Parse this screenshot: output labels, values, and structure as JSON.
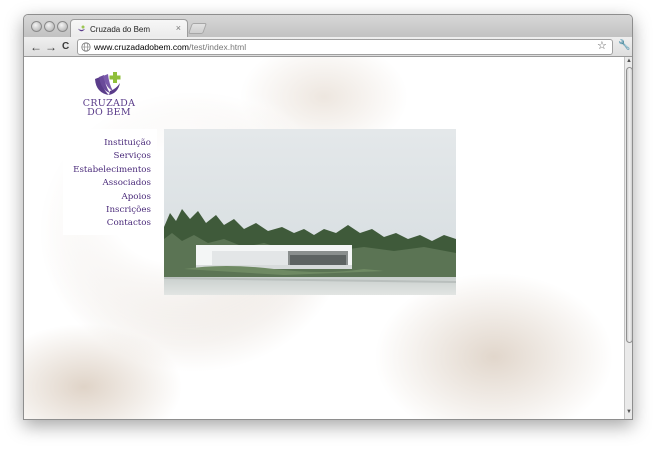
{
  "browser": {
    "tab_title": "Cruzada do Bem",
    "tab_close": "×",
    "url_host": "www.cruzadadobem.com",
    "url_path": "/test/index.html",
    "back_icon": "←",
    "forward_icon": "→",
    "reload_icon": "C",
    "star_icon": "☆",
    "wrench_icon": "🔧"
  },
  "logo": {
    "line1": "CRUZADA",
    "line2": "DO BEM",
    "colors": {
      "hands": "#5a3c8a",
      "cross": "#8fbf3a"
    }
  },
  "menu": {
    "items": [
      {
        "label": "Instituição"
      },
      {
        "label": "Serviços"
      },
      {
        "label": "Estabelecimentos"
      },
      {
        "label": "Associados"
      },
      {
        "label": "Apoios"
      },
      {
        "label": "Inscrições"
      },
      {
        "label": "Contactos"
      }
    ]
  },
  "colors": {
    "accent": "#4a2a7a"
  }
}
